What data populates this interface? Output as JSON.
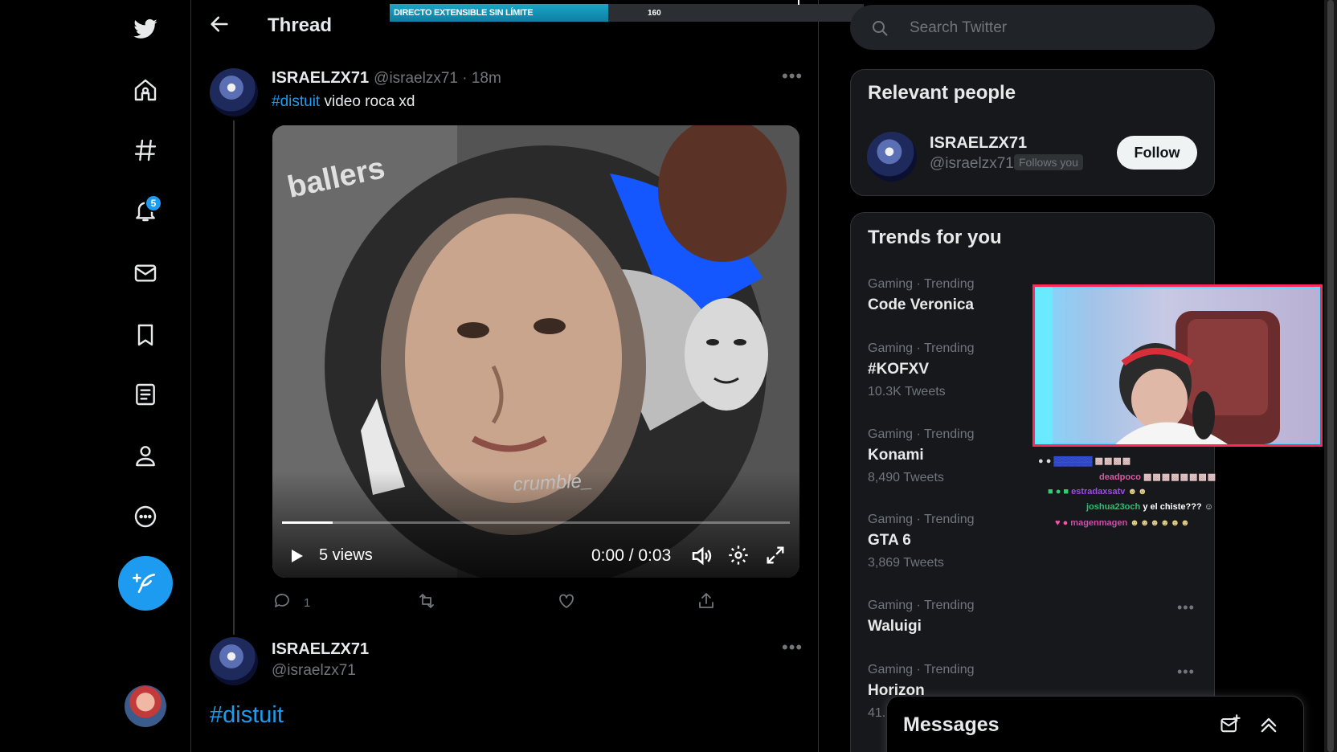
{
  "stream_bar": {
    "label": "DIRECTO EXTENSIBLE SIN LÍMITE",
    "value": "160",
    "max": "250",
    "fill_fraction": 0.64
  },
  "nav": {
    "items": [
      {
        "name": "twitter-logo-icon"
      },
      {
        "name": "home-icon"
      },
      {
        "name": "explore-hashtag-icon"
      },
      {
        "name": "notifications-bell-icon"
      },
      {
        "name": "messages-mail-icon"
      },
      {
        "name": "bookmarks-icon"
      },
      {
        "name": "lists-icon"
      },
      {
        "name": "profile-icon"
      },
      {
        "name": "more-icon"
      }
    ],
    "notification_count": "5"
  },
  "header": {
    "title": "Thread"
  },
  "tweet": {
    "display_name": "ISRAELZX71",
    "handle_time": "@israelzx71 · 18m",
    "hashtag": "#distuit",
    "text": " video roca xd",
    "video": {
      "views": "5 views",
      "time": "0:00 / 0:03",
      "progress_fraction": 0.1
    },
    "reply_count": "1"
  },
  "reply_tweet": {
    "display_name": "ISRAELZX71",
    "handle": "@israelzx71",
    "hashtag": "#distuit"
  },
  "search": {
    "placeholder": "Search Twitter"
  },
  "relevant_people": {
    "title": "Relevant people",
    "person": {
      "display_name": "ISRAELZX71",
      "handle": "@israelzx71",
      "follows_you": "Follows you",
      "follow_label": "Follow"
    }
  },
  "trends": {
    "title": "Trends for you",
    "items": [
      {
        "meta": "Gaming · Trending",
        "name": "Code Veronica",
        "count": ""
      },
      {
        "meta": "Gaming · Trending",
        "name": "#KOFXV",
        "count": "10.3K Tweets"
      },
      {
        "meta": "Gaming · Trending",
        "name": "Konami",
        "count": "8,490 Tweets"
      },
      {
        "meta": "Gaming · Trending",
        "name": "GTA 6",
        "count": "3,869 Tweets"
      },
      {
        "meta": "Gaming · Trending",
        "name": "Waluigi",
        "count": ""
      },
      {
        "meta": "Gaming · Trending",
        "name": "Horizon",
        "count": "41."
      }
    ]
  },
  "stream_chat": [
    {
      "user": "deadpoco",
      "message": "",
      "color": "#d55aa0"
    },
    {
      "user": "estradaxsatv",
      "message": "",
      "color": "#9b4de0"
    },
    {
      "user": "joshua23och",
      "message": "y el chiste???",
      "color": "#2fbf71"
    },
    {
      "user": "magenmagen",
      "message": "",
      "color": "#d04da8"
    }
  ],
  "messages_dock": {
    "title": "Messages"
  },
  "colors": {
    "accent": "#1d9bf0",
    "background": "#000000",
    "panel": "#16181c"
  }
}
